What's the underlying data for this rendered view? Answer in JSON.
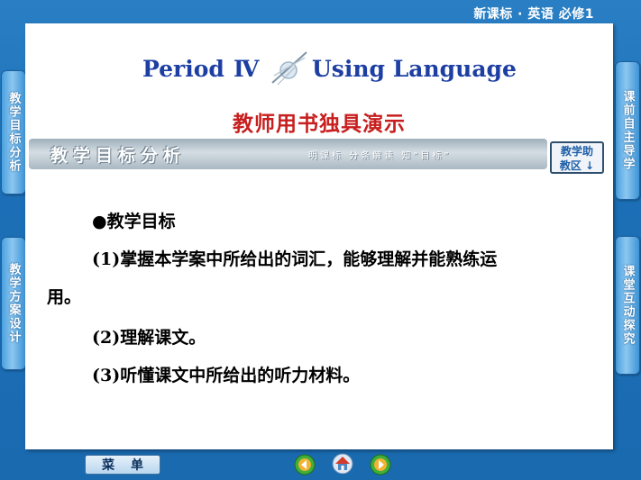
{
  "header": {
    "course": "新课标 · 英语 必修1"
  },
  "left_tabs": [
    {
      "label": "教学目标分析"
    },
    {
      "label": "教学方案设计"
    }
  ],
  "right_tabs": [
    {
      "label": "课前自主导学"
    },
    {
      "label": "课堂互动探究"
    }
  ],
  "title": {
    "period": "Period",
    "roman": "Ⅳ",
    "topic": "Using Language"
  },
  "subtitle": "教师用书独具演示",
  "banner": {
    "title": "教学目标分析",
    "slogan": "明课标  分条解读  知“目标”",
    "assist_line1": "教学助",
    "assist_line2": "教区 ↓"
  },
  "content": {
    "heading": "●教学目标",
    "item1_line1": "(1)掌握本学案中所给出的词汇，能够理解并能熟练运",
    "item1_line2": "用。",
    "item2": "(2)理解课文。",
    "item3": "(3)听懂课文中所给出的听力材料。"
  },
  "bottom": {
    "menu_label": "菜单"
  },
  "colors": {
    "title_blue": "#1d3fa3",
    "subtitle_red": "#c81e1e",
    "background": "#1c6fb6"
  }
}
